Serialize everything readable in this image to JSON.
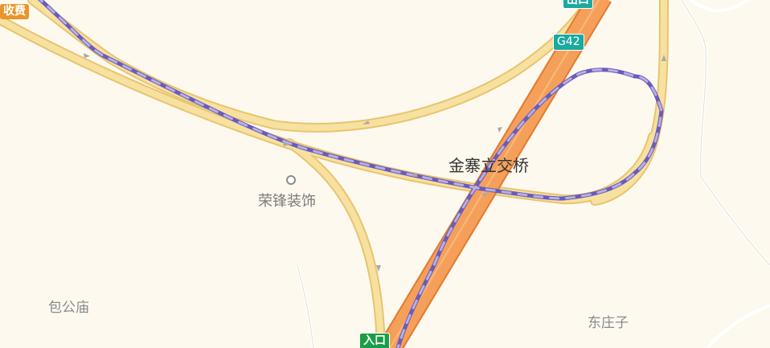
{
  "badges": {
    "toll": "收费",
    "exit": "出口",
    "entry": "入口",
    "highway": "G42"
  },
  "labels": {
    "interchange": "金寨立交桥",
    "poi": "荣锋装饰",
    "place_west": "包公庙",
    "place_east": "东庄子"
  },
  "colors": {
    "background": "#fdf9ef",
    "ramp_fill": "#f7e1a0",
    "ramp_casing": "#e9c46e",
    "highway_fill": "#f5a05a",
    "highway_casing": "#e27a2e",
    "route_line": "#6a5bbd",
    "route_dash": "#b8b0e0"
  },
  "icons": {
    "poi": "circle-poi-icon",
    "direction": "arrow-icon"
  }
}
